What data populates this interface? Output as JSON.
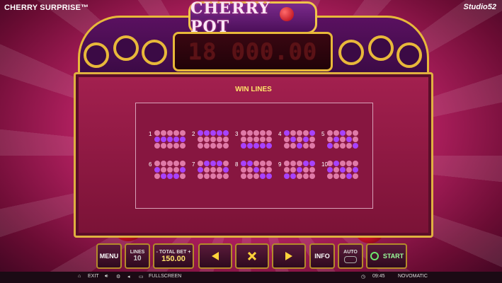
{
  "header": {
    "game_title": "CHERRY SURPRISE™",
    "studio": "Studio52"
  },
  "title_plate": "CHERRY POT",
  "jackpot": "18 000.00",
  "panel": {
    "title": "WIN LINES"
  },
  "win_lines": [
    {
      "label": "1",
      "cells": [
        [
          0,
          0,
          0,
          0,
          0
        ],
        [
          1,
          1,
          1,
          1,
          1
        ],
        [
          0,
          0,
          0,
          0,
          0
        ]
      ]
    },
    {
      "label": "2",
      "cells": [
        [
          1,
          1,
          1,
          1,
          1
        ],
        [
          0,
          0,
          0,
          0,
          0
        ],
        [
          0,
          0,
          0,
          0,
          0
        ]
      ]
    },
    {
      "label": "3",
      "cells": [
        [
          0,
          0,
          0,
          0,
          0
        ],
        [
          0,
          0,
          0,
          0,
          0
        ],
        [
          1,
          1,
          1,
          1,
          1
        ]
      ]
    },
    {
      "label": "4",
      "cells": [
        [
          1,
          0,
          0,
          0,
          1
        ],
        [
          0,
          1,
          0,
          1,
          0
        ],
        [
          0,
          0,
          1,
          0,
          0
        ]
      ]
    },
    {
      "label": "5",
      "cells": [
        [
          0,
          0,
          1,
          0,
          0
        ],
        [
          0,
          1,
          0,
          1,
          0
        ],
        [
          1,
          0,
          0,
          0,
          1
        ]
      ]
    },
    {
      "label": "6",
      "cells": [
        [
          0,
          0,
          0,
          0,
          0
        ],
        [
          1,
          0,
          0,
          0,
          1
        ],
        [
          0,
          1,
          1,
          1,
          0
        ]
      ]
    },
    {
      "label": "7",
      "cells": [
        [
          0,
          1,
          1,
          1,
          0
        ],
        [
          1,
          0,
          0,
          0,
          1
        ],
        [
          0,
          0,
          0,
          0,
          0
        ]
      ]
    },
    {
      "label": "8",
      "cells": [
        [
          1,
          1,
          0,
          0,
          0
        ],
        [
          0,
          0,
          1,
          0,
          0
        ],
        [
          0,
          0,
          0,
          1,
          1
        ]
      ]
    },
    {
      "label": "9",
      "cells": [
        [
          0,
          0,
          0,
          1,
          1
        ],
        [
          0,
          0,
          1,
          0,
          0
        ],
        [
          1,
          1,
          0,
          0,
          0
        ]
      ]
    },
    {
      "label": "10",
      "cells": [
        [
          0,
          1,
          0,
          0,
          0
        ],
        [
          1,
          0,
          1,
          0,
          1
        ],
        [
          0,
          0,
          0,
          1,
          0
        ]
      ]
    }
  ],
  "controls": {
    "menu": "MENU",
    "lines_label": "LINES",
    "lines_value": "10",
    "total_bet_label": "TOTAL BET",
    "total_bet_value": "150.00",
    "minus": "-",
    "plus": "+",
    "info": "INFO",
    "auto": "AUTO",
    "start": "START"
  },
  "status_bar": {
    "exit": "EXIT",
    "fullscreen": "FULLSCREEN",
    "time": "09:45",
    "brand": "NOVOMATIC"
  }
}
